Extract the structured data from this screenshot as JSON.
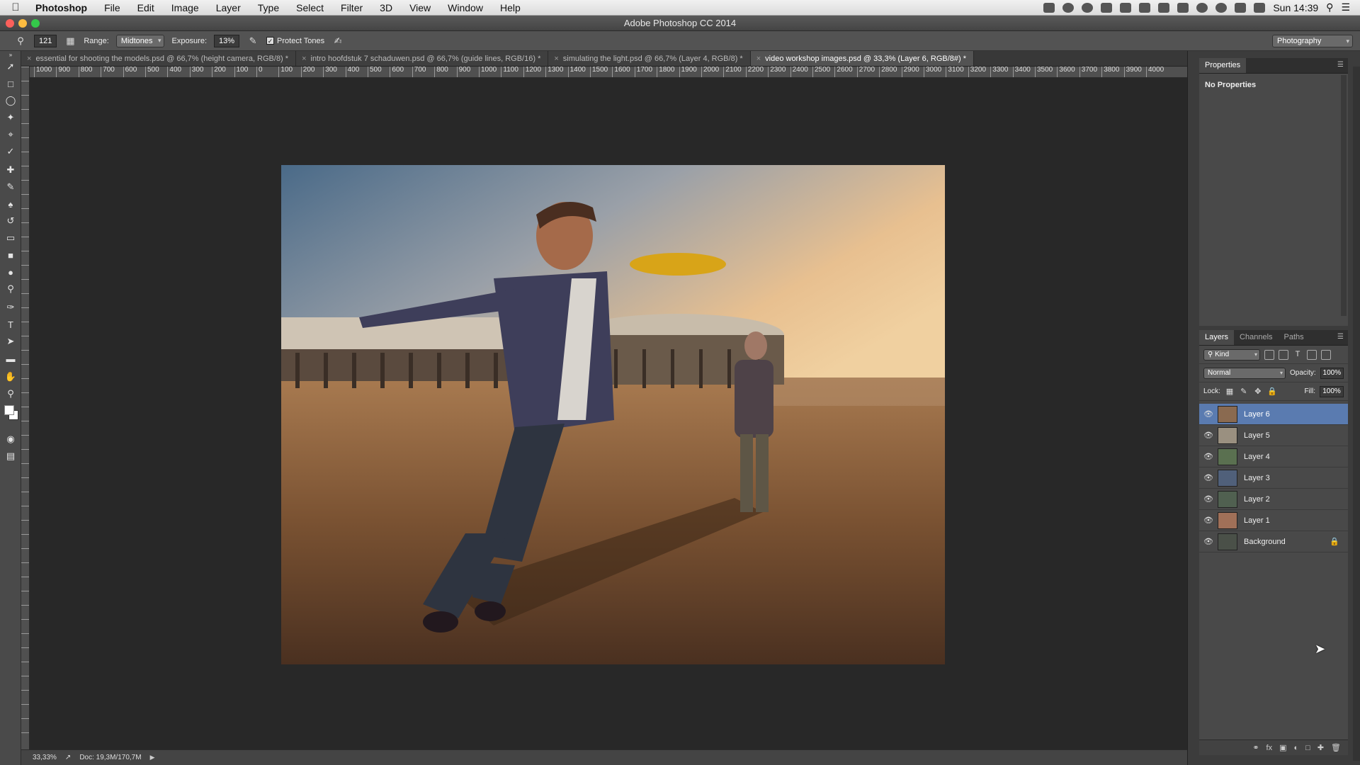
{
  "menubar": {
    "app_name": "Photoshop",
    "items": [
      "File",
      "Edit",
      "Image",
      "Layer",
      "Type",
      "Select",
      "Filter",
      "3D",
      "View",
      "Window",
      "Help"
    ],
    "clock": "Sun 14:39"
  },
  "window": {
    "title": "Adobe Photoshop CC 2014"
  },
  "options": {
    "brush_size": "121",
    "range_label": "Range:",
    "range_value": "Midtones",
    "exposure_label": "Exposure:",
    "exposure_value": "13%",
    "protect_tones_label": "Protect Tones",
    "workspace": "Photography"
  },
  "doc_tabs": [
    {
      "label": "essential for shooting the models.psd @ 66,7% (height camera, RGB/8) *",
      "active": false
    },
    {
      "label": "intro hoofdstuk 7 schaduwen.psd @ 66,7% (guide lines, RGB/16) *",
      "active": false
    },
    {
      "label": "simulating the light.psd @ 66,7% (Layer 4, RGB/8) *",
      "active": false
    },
    {
      "label": "video workshop images.psd @ 33,3% (Layer 6, RGB/8#) *",
      "active": true
    }
  ],
  "ruler_top": [
    "1000",
    "900",
    "800",
    "700",
    "600",
    "500",
    "400",
    "300",
    "200",
    "100",
    "0",
    "100",
    "200",
    "300",
    "400",
    "500",
    "600",
    "700",
    "800",
    "900",
    "1000",
    "1100",
    "1200",
    "1300",
    "1400",
    "1500",
    "1600",
    "1700",
    "1800",
    "1900",
    "2000",
    "2100",
    "2200",
    "2300",
    "2400",
    "2500",
    "2600",
    "2700",
    "2800",
    "2900",
    "3000",
    "3100",
    "3200",
    "3300",
    "3400",
    "3500",
    "3600",
    "3700",
    "3800",
    "3900",
    "4000"
  ],
  "status": {
    "zoom": "33,33%",
    "doc_info": "Doc: 19,3M/170,7M"
  },
  "properties": {
    "tab": "Properties",
    "body": "No Properties"
  },
  "layers_panel": {
    "tabs": [
      "Layers",
      "Channels",
      "Paths"
    ],
    "filter_kind": "Kind",
    "blend_mode": "Normal",
    "opacity_label": "Opacity:",
    "opacity_value": "100%",
    "lock_label": "Lock:",
    "fill_label": "Fill:",
    "fill_value": "100%",
    "layers": [
      {
        "name": "Layer 6",
        "selected": true,
        "thumb_color": "#8a6a50",
        "locked": false
      },
      {
        "name": "Layer 5",
        "selected": false,
        "thumb_color": "#9a9080",
        "locked": false
      },
      {
        "name": "Layer 4",
        "selected": false,
        "thumb_color": "#5a7050",
        "locked": false
      },
      {
        "name": "Layer 3",
        "selected": false,
        "thumb_color": "#50607a",
        "locked": false
      },
      {
        "name": "Layer 2",
        "selected": false,
        "thumb_color": "#506050",
        "locked": false
      },
      {
        "name": "Layer 1",
        "selected": false,
        "thumb_color": "#a07058",
        "locked": false
      },
      {
        "name": "Background",
        "selected": false,
        "thumb_color": "#4a5048",
        "locked": true
      }
    ]
  }
}
